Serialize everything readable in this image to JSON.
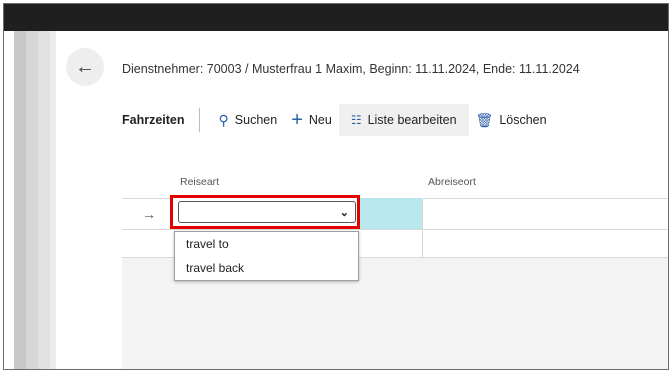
{
  "header": {
    "title": "Dienstnehmer: 70003 / Musterfrau 1 Maxim, Beginn: 11.11.2024, Ende: 11.11.2024"
  },
  "toolbar": {
    "section_title": "Fahrzeiten",
    "search_label": "Suchen",
    "new_label": "Neu",
    "edit_list_label": "Liste bearbeiten",
    "delete_label": "Löschen"
  },
  "grid": {
    "columns": [
      "Reiseart",
      "Abreiseort"
    ],
    "current_row_indicator": "→",
    "select": {
      "value": "",
      "options": [
        "travel to",
        "travel back"
      ]
    }
  },
  "icons": {
    "back": "back-arrow-icon",
    "search": "search-icon",
    "new": "plus-icon",
    "edit_list": "edit-list-icon",
    "delete": "trash-icon",
    "chevron": "chevron-down-icon"
  },
  "colors": {
    "accent": "#2b5fa7",
    "selection": "#b6e8ee",
    "highlight": "#e30000"
  }
}
